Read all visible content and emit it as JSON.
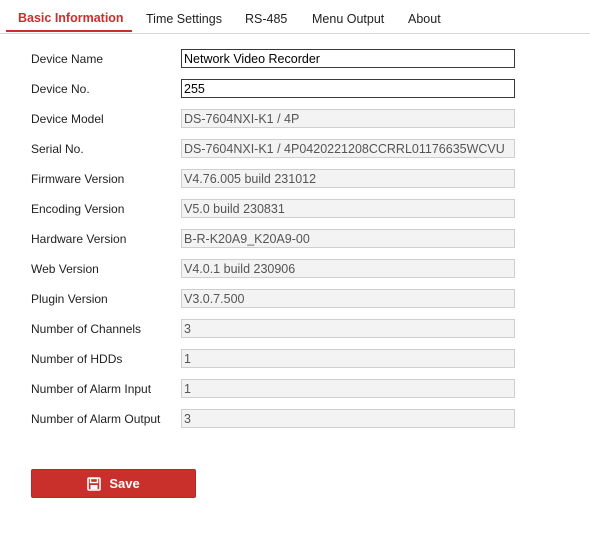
{
  "tabs": [
    {
      "label": "Basic Information",
      "active": true
    },
    {
      "label": "Time Settings",
      "active": false
    },
    {
      "label": "RS-485",
      "active": false
    },
    {
      "label": "Menu Output",
      "active": false
    },
    {
      "label": "About",
      "active": false
    }
  ],
  "form": {
    "device_name": {
      "label": "Device Name",
      "value": "Network Video Recorder"
    },
    "device_no": {
      "label": "Device No.",
      "value": "255"
    },
    "device_model": {
      "label": "Device Model",
      "value": "DS-7604NXI-K1 / 4P"
    },
    "serial_no": {
      "label": "Serial No.",
      "value": "DS-7604NXI-K1 / 4P0420221208CCRRL01176635WCVU"
    },
    "firmware_version": {
      "label": "Firmware Version",
      "value": "V4.76.005 build 231012"
    },
    "encoding_version": {
      "label": "Encoding Version",
      "value": "V5.0 build 230831"
    },
    "hardware_version": {
      "label": "Hardware Version",
      "value": "B-R-K20A9_K20A9-00"
    },
    "web_version": {
      "label": "Web Version",
      "value": "V4.0.1 build 230906"
    },
    "plugin_version": {
      "label": "Plugin Version",
      "value": "V3.0.7.500"
    },
    "channels": {
      "label": "Number of Channels",
      "value": "3"
    },
    "hdds": {
      "label": "Number of HDDs",
      "value": "1"
    },
    "alarm_input": {
      "label": "Number of Alarm Input",
      "value": "1"
    },
    "alarm_output": {
      "label": "Number of Alarm Output",
      "value": "3"
    }
  },
  "save_button": {
    "label": "Save",
    "icon": "save-icon"
  },
  "colors": {
    "accent": "#c9302c",
    "readonly_bg": "#f3f3f3",
    "readonly_border": "#cfcfcf"
  }
}
